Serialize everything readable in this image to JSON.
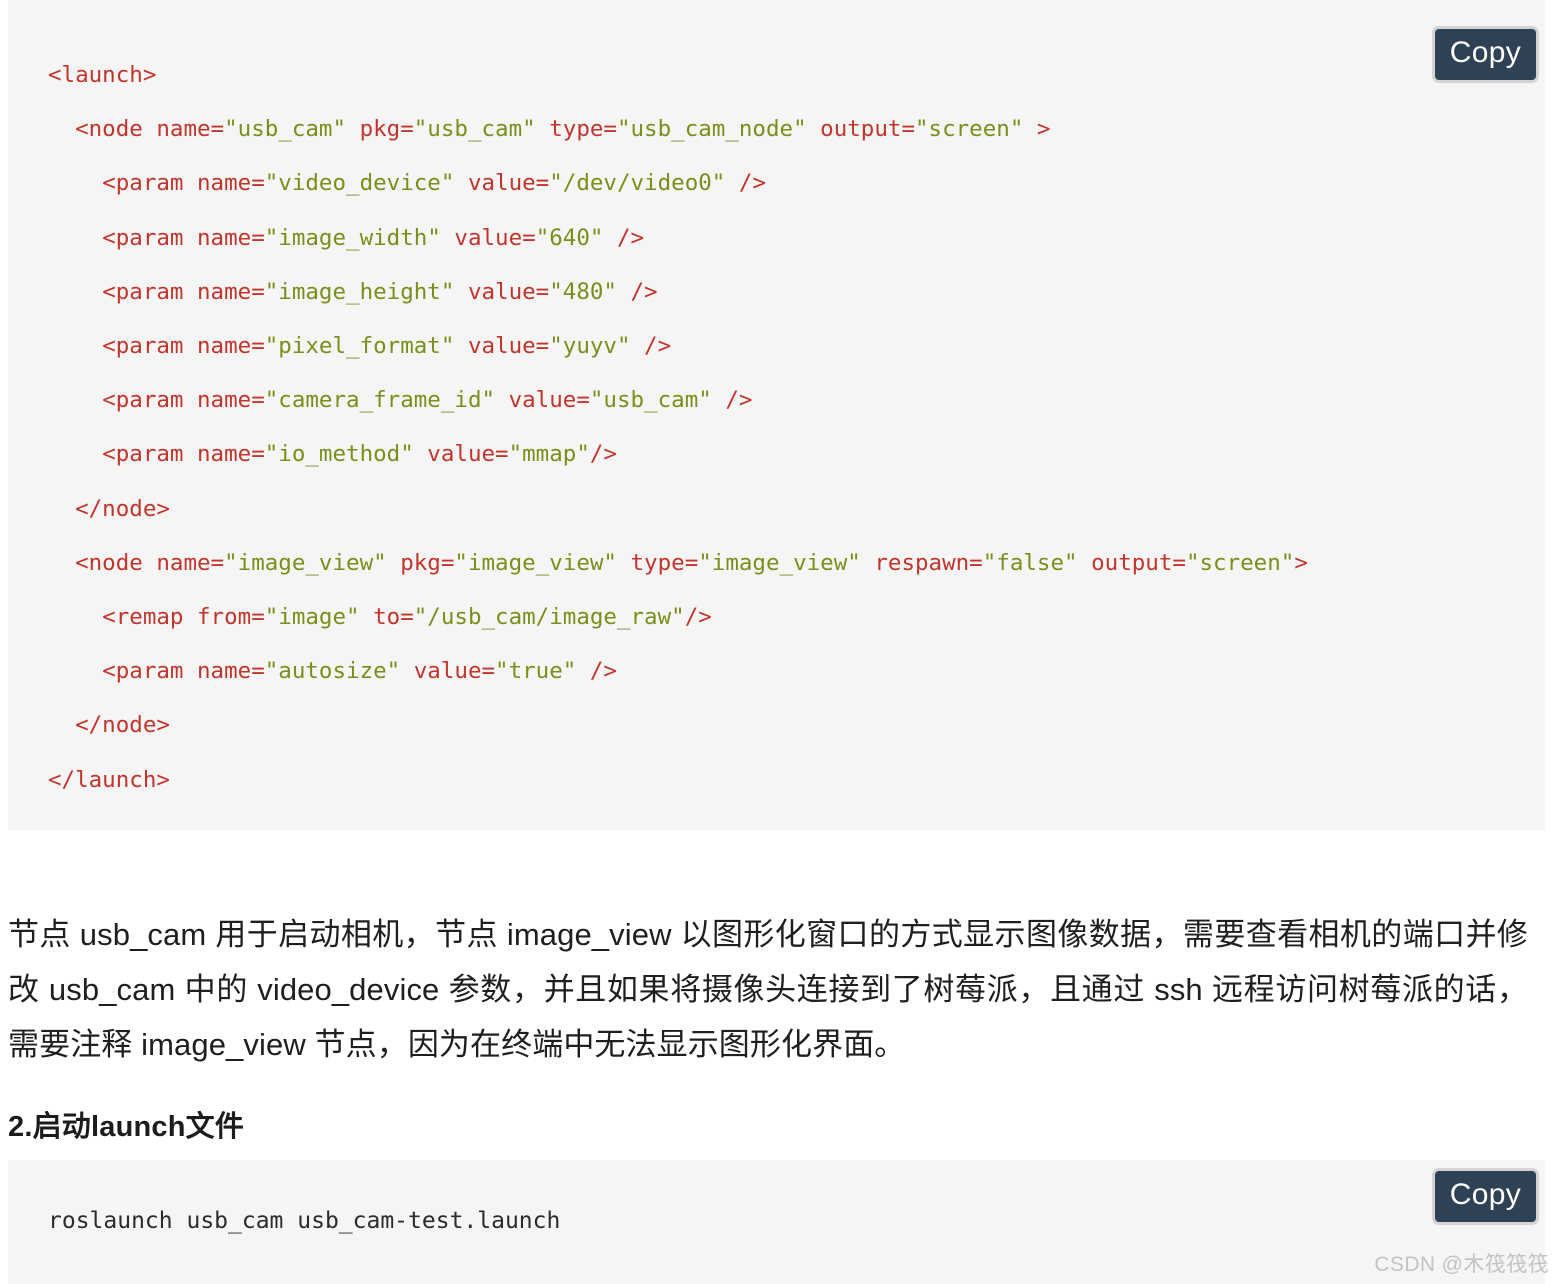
{
  "colors": {
    "code_background": "#f5f5f5",
    "tag_red": "#c1352c",
    "value_green": "#78901b",
    "copy_button_bg": "#2f4154",
    "copy_button_text": "#ffffff",
    "copy_button_border": "#d4d4d4",
    "body_text": "#1f1f1f",
    "watermark": "#c3c3c3"
  },
  "code_block_xml": {
    "language": "xml",
    "copy_label": "Copy",
    "lines": [
      {
        "indent": 0,
        "tokens": [
          {
            "t": "tag",
            "s": "<launch>"
          }
        ]
      },
      {
        "indent": 1,
        "tokens": [
          {
            "t": "tag",
            "s": "<node name="
          },
          {
            "t": "val",
            "s": "\"usb_cam\""
          },
          {
            "t": "tag",
            "s": " pkg="
          },
          {
            "t": "val",
            "s": "\"usb_cam\""
          },
          {
            "t": "tag",
            "s": " type="
          },
          {
            "t": "val",
            "s": "\"usb_cam_node\""
          },
          {
            "t": "tag",
            "s": " output="
          },
          {
            "t": "val",
            "s": "\"screen\""
          },
          {
            "t": "tag",
            "s": " >"
          }
        ]
      },
      {
        "indent": 2,
        "tokens": [
          {
            "t": "tag",
            "s": "<param name="
          },
          {
            "t": "val",
            "s": "\"video_device\""
          },
          {
            "t": "tag",
            "s": " value="
          },
          {
            "t": "val",
            "s": "\"/dev/video0\""
          },
          {
            "t": "tag",
            "s": " />"
          }
        ]
      },
      {
        "indent": 2,
        "tokens": [
          {
            "t": "tag",
            "s": "<param name="
          },
          {
            "t": "val",
            "s": "\"image_width\""
          },
          {
            "t": "tag",
            "s": " value="
          },
          {
            "t": "val",
            "s": "\"640\""
          },
          {
            "t": "tag",
            "s": " />"
          }
        ]
      },
      {
        "indent": 2,
        "tokens": [
          {
            "t": "tag",
            "s": "<param name="
          },
          {
            "t": "val",
            "s": "\"image_height\""
          },
          {
            "t": "tag",
            "s": " value="
          },
          {
            "t": "val",
            "s": "\"480\""
          },
          {
            "t": "tag",
            "s": " />"
          }
        ]
      },
      {
        "indent": 2,
        "tokens": [
          {
            "t": "tag",
            "s": "<param name="
          },
          {
            "t": "val",
            "s": "\"pixel_format\""
          },
          {
            "t": "tag",
            "s": " value="
          },
          {
            "t": "val",
            "s": "\"yuyv\""
          },
          {
            "t": "tag",
            "s": " />"
          }
        ]
      },
      {
        "indent": 2,
        "tokens": [
          {
            "t": "tag",
            "s": "<param name="
          },
          {
            "t": "val",
            "s": "\"camera_frame_id\""
          },
          {
            "t": "tag",
            "s": " value="
          },
          {
            "t": "val",
            "s": "\"usb_cam\""
          },
          {
            "t": "tag",
            "s": " />"
          }
        ]
      },
      {
        "indent": 2,
        "tokens": [
          {
            "t": "tag",
            "s": "<param name="
          },
          {
            "t": "val",
            "s": "\"io_method\""
          },
          {
            "t": "tag",
            "s": " value="
          },
          {
            "t": "val",
            "s": "\"mmap\""
          },
          {
            "t": "tag",
            "s": "/>"
          }
        ]
      },
      {
        "indent": 1,
        "tokens": [
          {
            "t": "tag",
            "s": "</node>"
          }
        ]
      },
      {
        "indent": 1,
        "tokens": [
          {
            "t": "tag",
            "s": "<node name="
          },
          {
            "t": "val",
            "s": "\"image_view\""
          },
          {
            "t": "tag",
            "s": " pkg="
          },
          {
            "t": "val",
            "s": "\"image_view\""
          },
          {
            "t": "tag",
            "s": " type="
          },
          {
            "t": "val",
            "s": "\"image_view\""
          },
          {
            "t": "tag",
            "s": " respawn="
          },
          {
            "t": "val",
            "s": "\"false\""
          },
          {
            "t": "tag",
            "s": " output="
          },
          {
            "t": "val",
            "s": "\"screen\""
          },
          {
            "t": "tag",
            "s": ">"
          }
        ]
      },
      {
        "indent": 2,
        "tokens": [
          {
            "t": "tag",
            "s": "<remap from="
          },
          {
            "t": "val",
            "s": "\"image\""
          },
          {
            "t": "tag",
            "s": " to="
          },
          {
            "t": "val",
            "s": "\"/usb_cam/image_raw\""
          },
          {
            "t": "tag",
            "s": "/>"
          }
        ]
      },
      {
        "indent": 2,
        "tokens": [
          {
            "t": "tag",
            "s": "<param name="
          },
          {
            "t": "val",
            "s": "\"autosize\""
          },
          {
            "t": "tag",
            "s": " value="
          },
          {
            "t": "val",
            "s": "\"true\""
          },
          {
            "t": "tag",
            "s": " />"
          }
        ]
      },
      {
        "indent": 1,
        "tokens": [
          {
            "t": "tag",
            "s": "</node>"
          }
        ]
      },
      {
        "indent": 0,
        "tokens": [
          {
            "t": "tag",
            "s": "</launch>"
          }
        ]
      }
    ]
  },
  "paragraph": {
    "text": "节点 usb_cam 用于启动相机，节点 image_view 以图形化窗口的方式显示图像数据，需要查看相机的端口并修改 usb_cam 中的 video_device 参数，并且如果将摄像头连接到了树莓派，且通过 ssh 远程访问树莓派的话，需要注释 image_view 节点，因为在终端中无法显示图形化界面。"
  },
  "heading": {
    "text": "2.启动launch文件"
  },
  "code_block_shell": {
    "language": "shell",
    "copy_label": "Copy",
    "command": "roslaunch usb_cam usb_cam-test.launch"
  },
  "watermark": {
    "text": "CSDN @木筏筏筏"
  }
}
